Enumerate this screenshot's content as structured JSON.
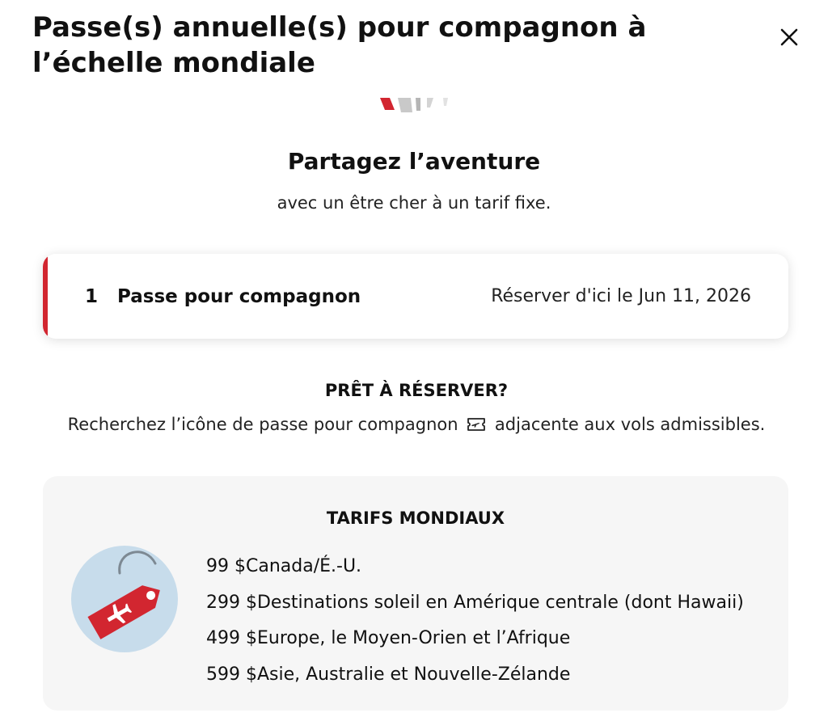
{
  "header": {
    "title": "Passe(s) annuelle(s) pour compagnon à l’échelle mondiale",
    "close_icon": "close-icon"
  },
  "hero": {
    "heading": "Partagez l’aventure",
    "subheading": "avec un être cher à un tarif fixe."
  },
  "pass": {
    "count": "1",
    "label": "Passe pour compagnon",
    "booking_deadline": "Réserver d'ici le Jun 11, 2026"
  },
  "ready": {
    "heading": "PRÊT À RÉSERVER?",
    "text_before_icon": "Recherchez l’icône de passe pour compagnon",
    "icon": "companion-pass-ticket-icon",
    "text_after_icon": "adjacente aux vols admissibles."
  },
  "rates": {
    "title": "TARIFS MONDIAUX",
    "icon": "price-tag-plane-icon",
    "items": [
      {
        "price": "99 $",
        "destination": "Canada/É.-U."
      },
      {
        "price": "299 $",
        "destination": "Destinations soleil en Amérique centrale (dont Hawaii)"
      },
      {
        "price": "499 $",
        "destination": "Europe, le Moyen-Orien et l’Afrique"
      },
      {
        "price": "599 $",
        "destination": "Asie, Australie et Nouvelle-Zélande"
      }
    ]
  },
  "colors": {
    "accent": "#d22630",
    "badge_background": "#c7dceb",
    "card_background": "#f6f6f6"
  }
}
